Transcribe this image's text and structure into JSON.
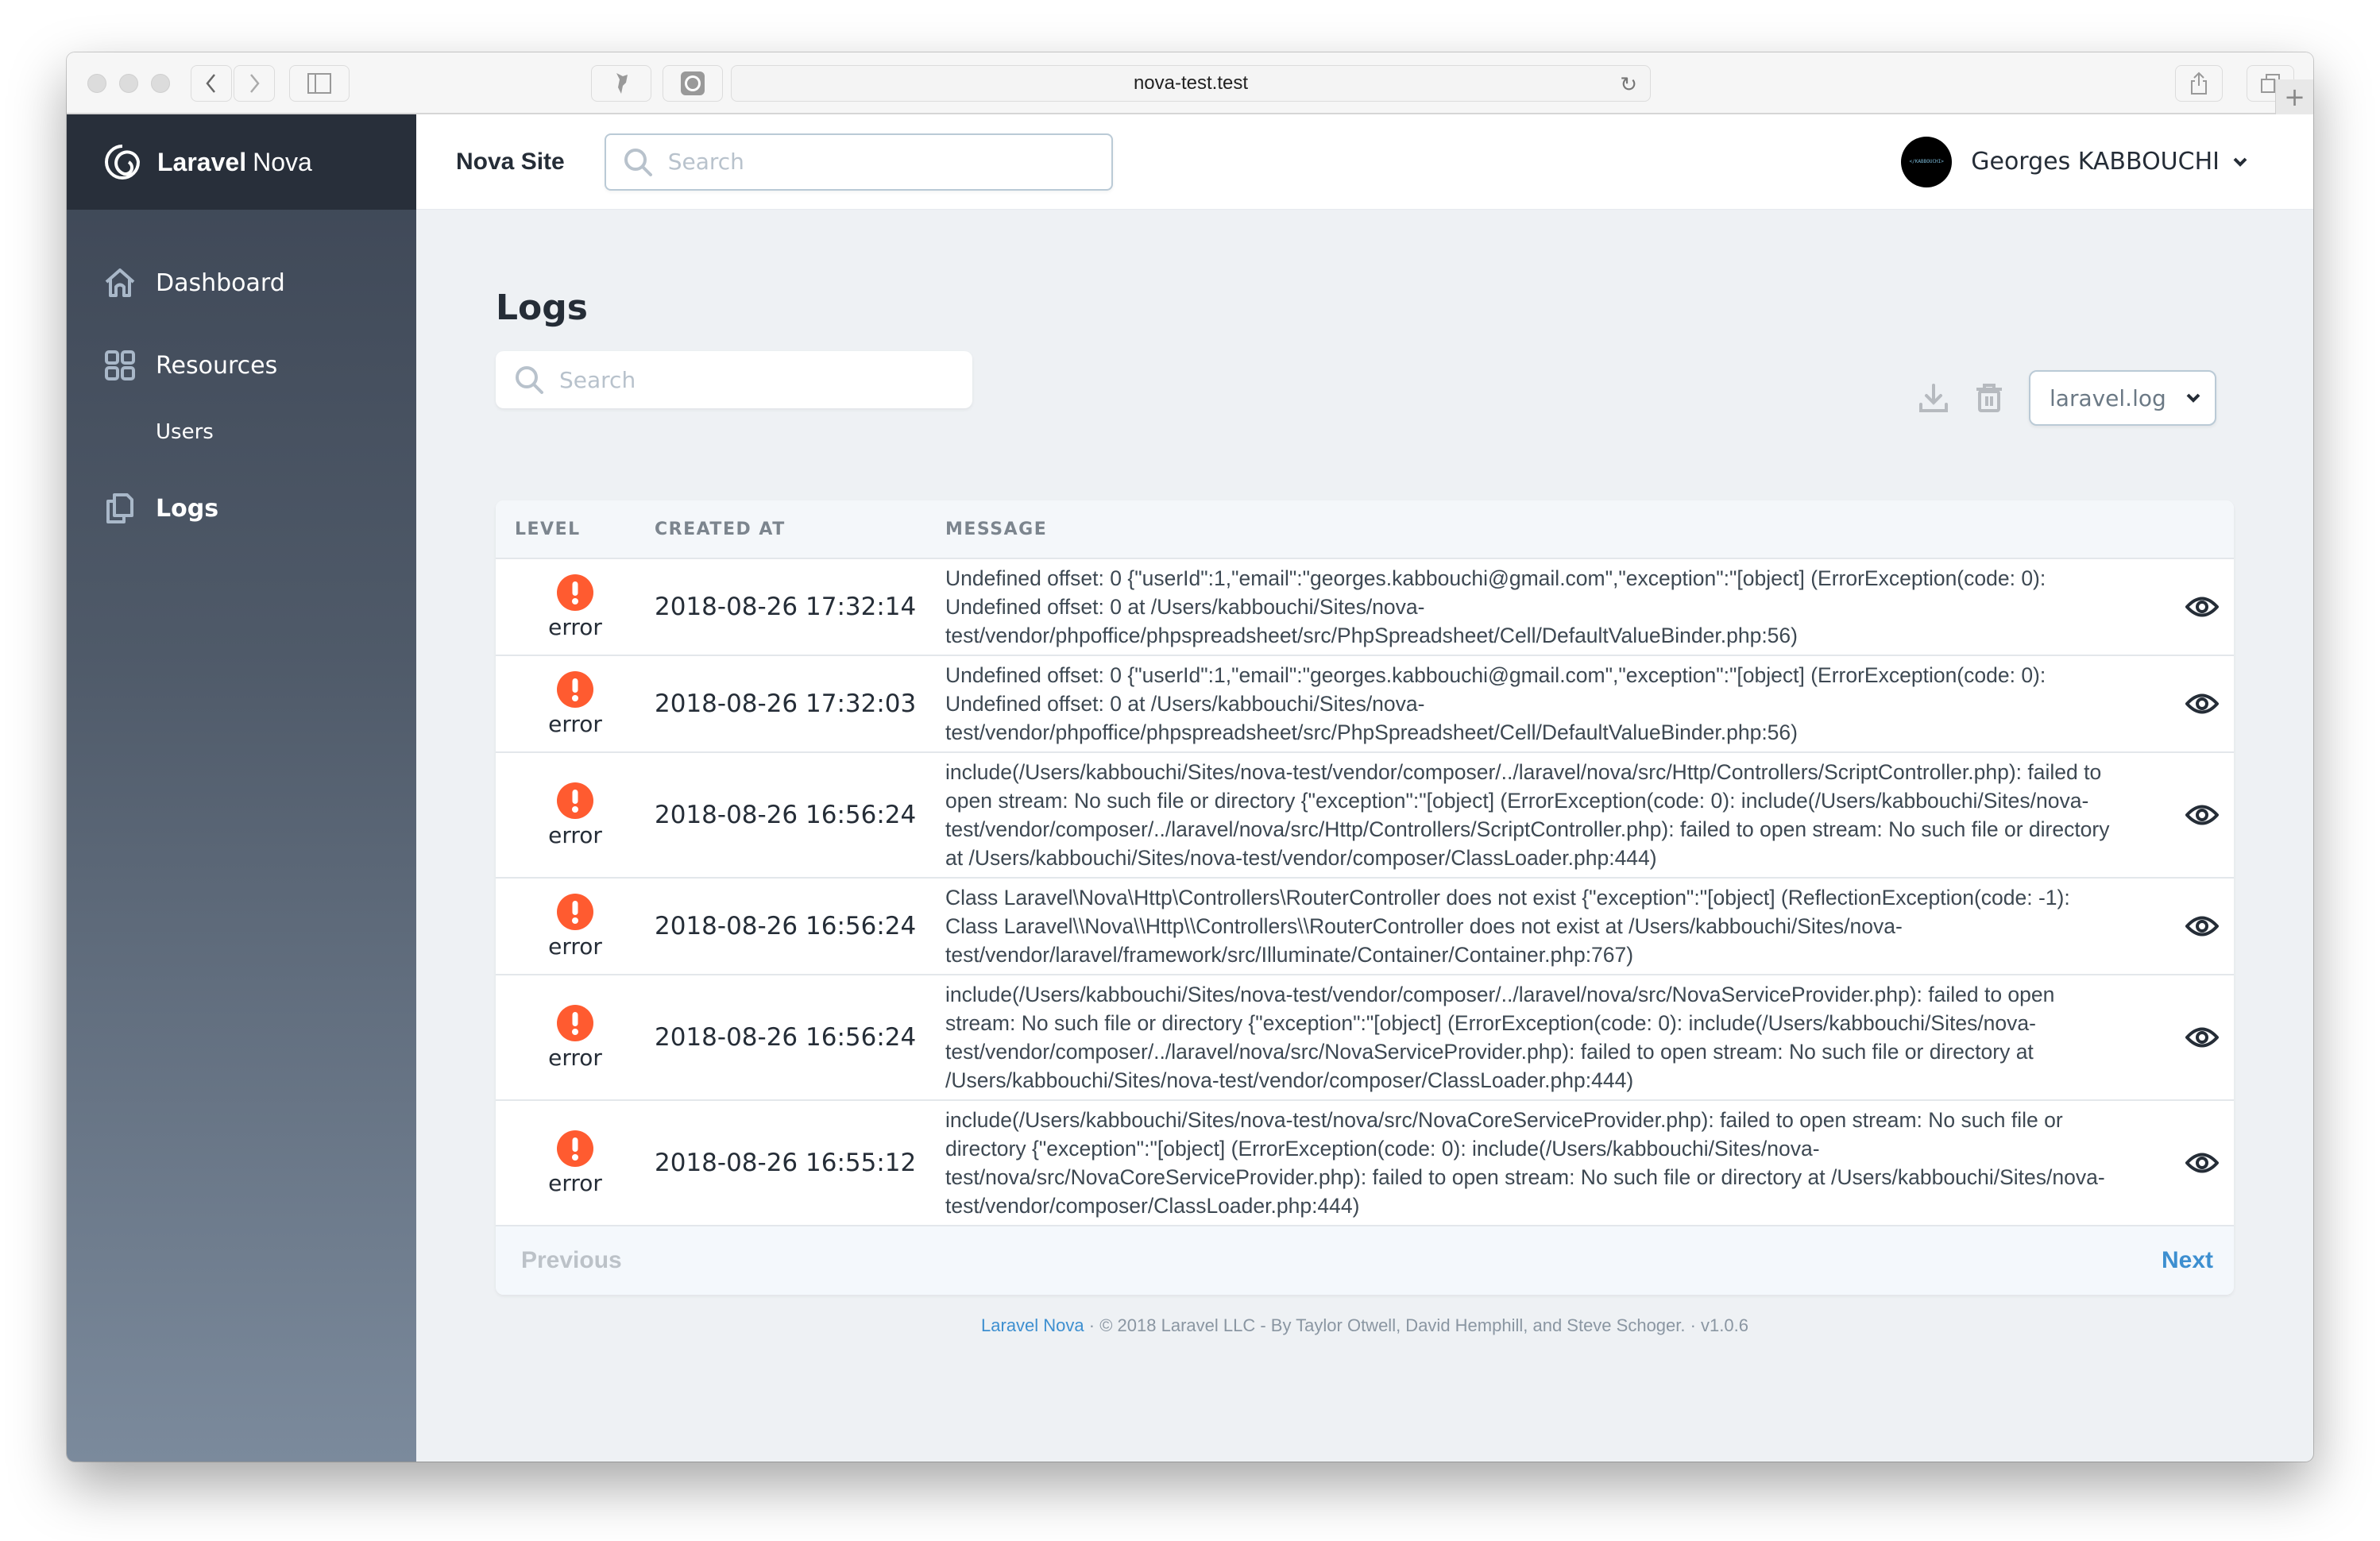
{
  "browser": {
    "url": "nova-test.test"
  },
  "brand": {
    "name_bold": "Laravel",
    "name_light": "Nova"
  },
  "sidebar": {
    "items": [
      {
        "label": "Dashboard",
        "icon": "home-icon"
      },
      {
        "label": "Resources",
        "icon": "grid-icon"
      },
      {
        "label": "Users"
      },
      {
        "label": "Logs",
        "icon": "documents-icon",
        "active": true
      }
    ]
  },
  "topbar": {
    "site_name": "Nova Site",
    "search_placeholder": "Search",
    "user_name": "Georges KABBOUCHI",
    "avatar_text": "</KABBOUCHI>"
  },
  "page": {
    "title": "Logs",
    "search_placeholder": "Search",
    "selected_file": "laravel.log"
  },
  "table": {
    "headers": {
      "level": "LEVEL",
      "created_at": "CREATED AT",
      "message": "MESSAGE"
    },
    "rows": [
      {
        "level": "error",
        "created_at": "2018-08-26 17:32:14",
        "message": "Undefined offset: 0 {\"userId\":1,\"email\":\"georges.kabbouchi@gmail.com\",\"exception\":\"[object] (ErrorException(code: 0): Undefined offset: 0 at /Users/kabbouchi/Sites/nova-test/vendor/phpoffice/phpspreadsheet/src/PhpSpreadsheet/Cell/DefaultValueBinder.php:56)"
      },
      {
        "level": "error",
        "created_at": "2018-08-26 17:32:03",
        "message": "Undefined offset: 0 {\"userId\":1,\"email\":\"georges.kabbouchi@gmail.com\",\"exception\":\"[object] (ErrorException(code: 0): Undefined offset: 0 at /Users/kabbouchi/Sites/nova-test/vendor/phpoffice/phpspreadsheet/src/PhpSpreadsheet/Cell/DefaultValueBinder.php:56)"
      },
      {
        "level": "error",
        "created_at": "2018-08-26 16:56:24",
        "message": "include(/Users/kabbouchi/Sites/nova-test/vendor/composer/../laravel/nova/src/Http/Controllers/ScriptController.php): failed to open stream: No such file or directory {\"exception\":\"[object] (ErrorException(code: 0): include(/Users/kabbouchi/Sites/nova-test/vendor/composer/../laravel/nova/src/Http/Controllers/ScriptController.php): failed to open stream: No such file or directory at /Users/kabbouchi/Sites/nova-test/vendor/composer/ClassLoader.php:444)"
      },
      {
        "level": "error",
        "created_at": "2018-08-26 16:56:24",
        "message": "Class Laravel\\Nova\\Http\\Controllers\\RouterController does not exist {\"exception\":\"[object] (ReflectionException(code: -1): Class Laravel\\\\Nova\\\\Http\\\\Controllers\\\\RouterController does not exist at /Users/kabbouchi/Sites/nova-test/vendor/laravel/framework/src/Illuminate/Container/Container.php:767)"
      },
      {
        "level": "error",
        "created_at": "2018-08-26 16:56:24",
        "message": "include(/Users/kabbouchi/Sites/nova-test/vendor/composer/../laravel/nova/src/NovaServiceProvider.php): failed to open stream: No such file or directory {\"exception\":\"[object] (ErrorException(code: 0): include(/Users/kabbouchi/Sites/nova-test/vendor/composer/../laravel/nova/src/NovaServiceProvider.php): failed to open stream: No such file or directory at /Users/kabbouchi/Sites/nova-test/vendor/composer/ClassLoader.php:444)"
      },
      {
        "level": "error",
        "created_at": "2018-08-26 16:55:12",
        "message": "include(/Users/kabbouchi/Sites/nova-test/nova/src/NovaCoreServiceProvider.php): failed to open stream: No such file or directory {\"exception\":\"[object] (ErrorException(code: 0): include(/Users/kabbouchi/Sites/nova-test/nova/src/NovaCoreServiceProvider.php): failed to open stream: No such file or directory at /Users/kabbouchi/Sites/nova-test/vendor/composer/ClassLoader.php:444)"
      }
    ]
  },
  "pagination": {
    "previous": "Previous",
    "next": "Next"
  },
  "footer": {
    "link": "Laravel Nova",
    "text": "·  © 2018 Laravel LLC - By Taylor Otwell, David Hemphill, and Steve Schoger.  ·  v1.0.6"
  },
  "colors": {
    "error": "#ff5b30",
    "accent": "#3d8fd0",
    "sidebar_top": "#282f3a"
  }
}
